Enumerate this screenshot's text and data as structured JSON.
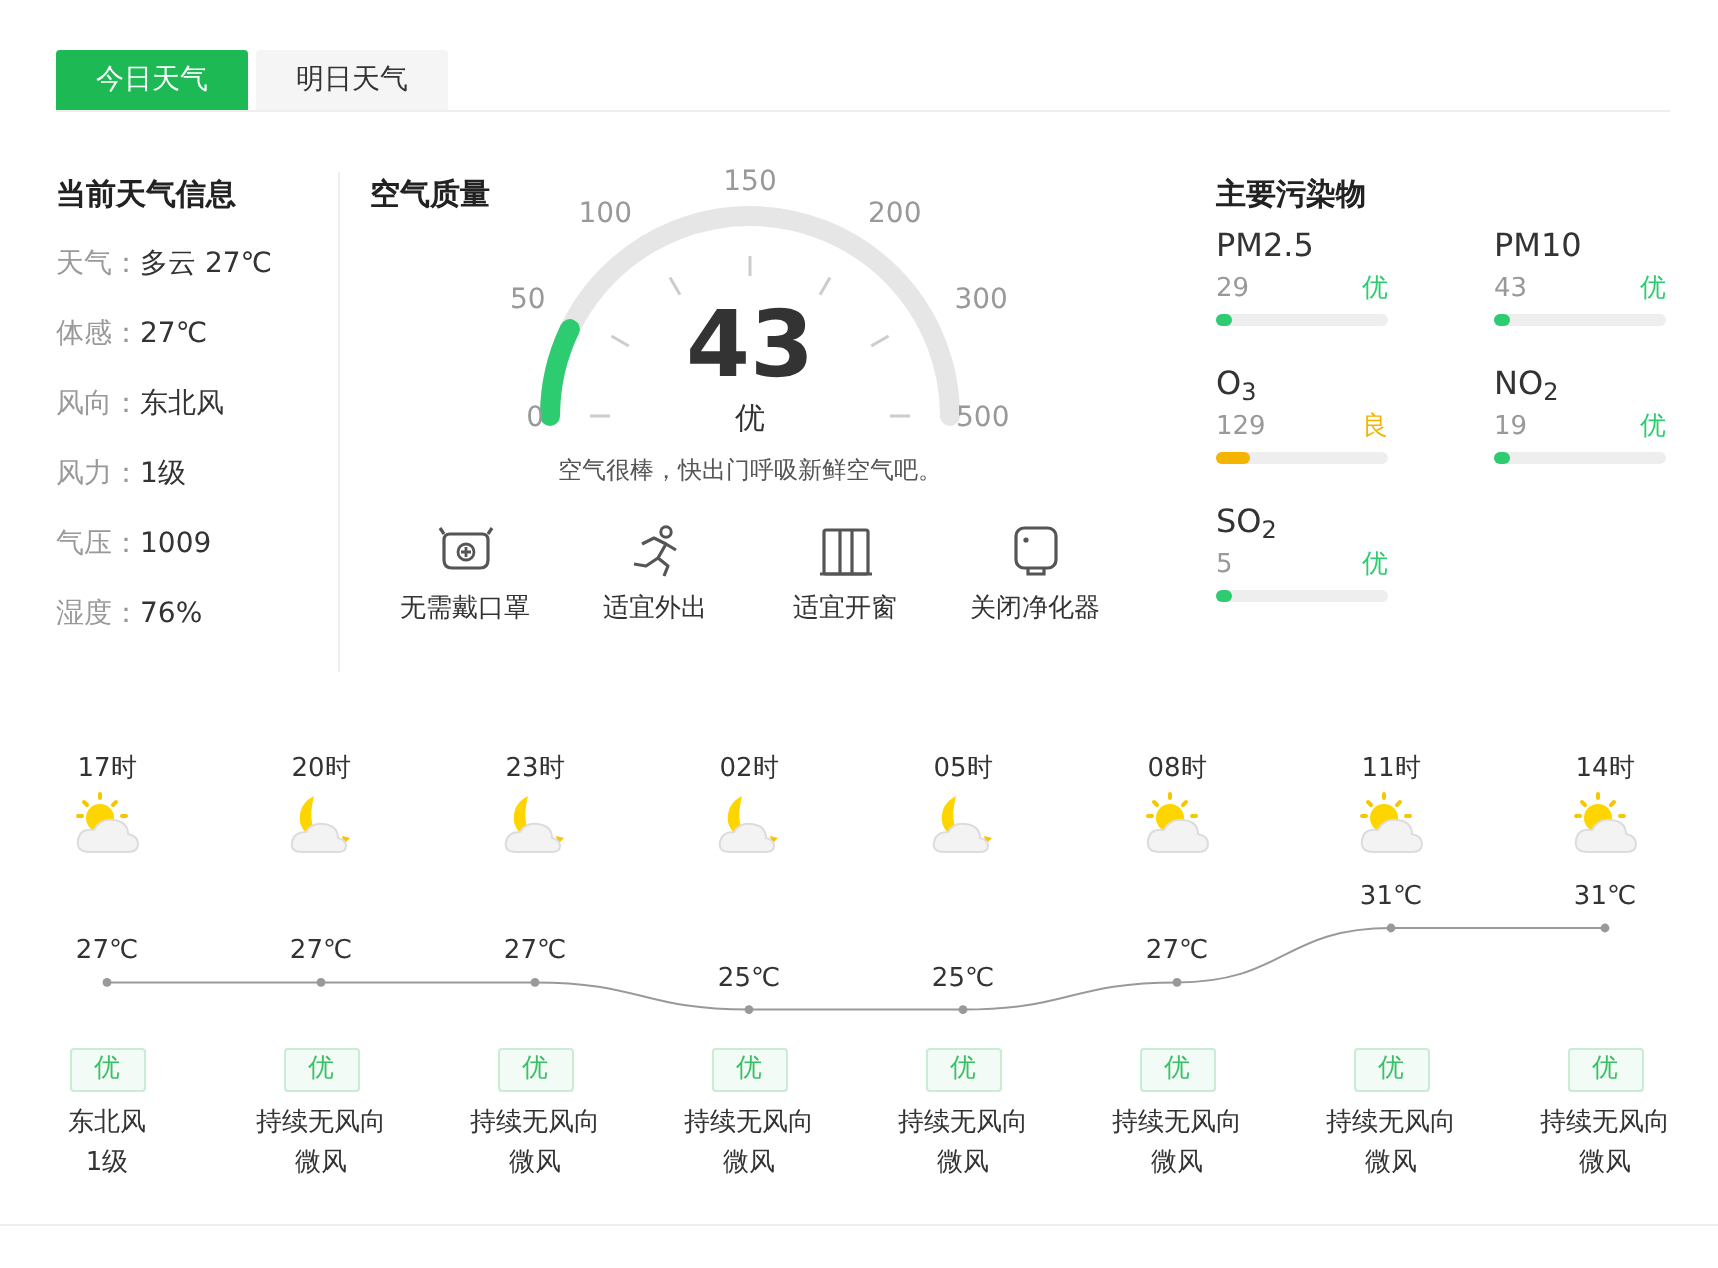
{
  "tabs": [
    {
      "label": "今日天气",
      "selected": true
    },
    {
      "label": "明日天气",
      "selected": false
    }
  ],
  "current": {
    "title": "当前天气信息",
    "rows": [
      {
        "label": "天气：",
        "value": "多云 27℃"
      },
      {
        "label": "体感：",
        "value": "27℃"
      },
      {
        "label": "风向：",
        "value": "东北风"
      },
      {
        "label": "风力：",
        "value": "1级"
      },
      {
        "label": "气压：",
        "value": "1009"
      },
      {
        "label": "湿度：",
        "value": "76%"
      }
    ]
  },
  "air_quality": {
    "title": "空气质量",
    "ticks": [
      "0",
      "50",
      "100",
      "150",
      "200",
      "300",
      "500"
    ],
    "value": "43",
    "grade": "优",
    "level": 0.143,
    "color": "#2ecc71",
    "advice": "空气很棒，快出门呼吸新鲜空气吧。",
    "tips": [
      {
        "kind": "mask",
        "label": "无需戴口罩"
      },
      {
        "kind": "runner",
        "label": "适宜外出"
      },
      {
        "kind": "window",
        "label": "适宜开窗"
      },
      {
        "kind": "purifier",
        "label": "关闭净化器"
      }
    ]
  },
  "pollutants": {
    "title": "主要污染物",
    "items": [
      {
        "name": "PM2.5",
        "value": "29",
        "grade": "优",
        "level": 0.05,
        "color": "#2ecc71"
      },
      {
        "name": "PM10",
        "value": "43",
        "grade": "优",
        "level": 0.05,
        "color": "#2ecc71"
      },
      {
        "name": "O$_{3}$",
        "value": "129",
        "grade": "良",
        "level": 0.2,
        "color": "#f5b400"
      },
      {
        "name": "NO$_{2}$",
        "value": "19",
        "grade": "优",
        "level": 0.05,
        "color": "#2ecc71"
      },
      {
        "name": "SO$_{2}$",
        "value": "5",
        "grade": "优",
        "level": 0.05,
        "color": "#2ecc71"
      }
    ]
  },
  "hourly": [
    {
      "time": "17时",
      "kind": "day",
      "temp": "27℃",
      "aqi": "优",
      "wind": [
        "东北风",
        "1级"
      ]
    },
    {
      "time": "20时",
      "kind": "night",
      "temp": "27℃",
      "aqi": "优",
      "wind": [
        "持续无风向",
        "微风"
      ]
    },
    {
      "time": "23时",
      "kind": "night",
      "temp": "27℃",
      "aqi": "优",
      "wind": [
        "持续无风向",
        "微风"
      ]
    },
    {
      "time": "02时",
      "kind": "night",
      "temp": "25℃",
      "aqi": "优",
      "wind": [
        "持续无风向",
        "微风"
      ]
    },
    {
      "time": "05时",
      "kind": "night",
      "temp": "25℃",
      "aqi": "优",
      "wind": [
        "持续无风向",
        "微风"
      ]
    },
    {
      "time": "08时",
      "kind": "day",
      "temp": "27℃",
      "aqi": "优",
      "wind": [
        "持续无风向",
        "微风"
      ]
    },
    {
      "time": "11时",
      "kind": "day",
      "temp": "31℃",
      "aqi": "优",
      "wind": [
        "持续无风向",
        "微风"
      ]
    },
    {
      "time": "14时",
      "kind": "day",
      "temp": "31℃",
      "aqi": "优",
      "wind": [
        "持续无风向",
        "微风"
      ]
    }
  ]
}
